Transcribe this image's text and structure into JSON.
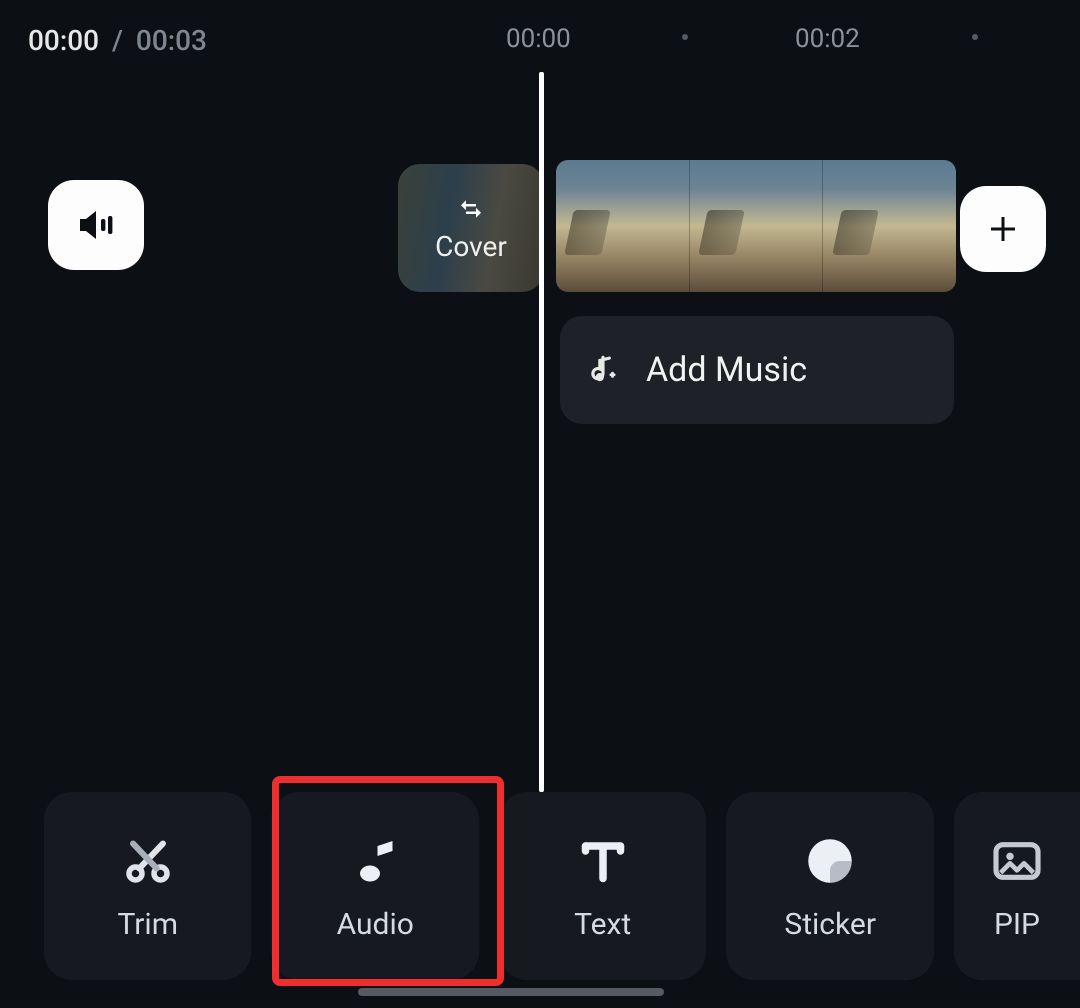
{
  "timecode": {
    "current": "00:00",
    "separator": "/",
    "total": "00:03"
  },
  "ruler": {
    "marks": [
      "00:00",
      "00:02"
    ]
  },
  "cover": {
    "label": "Cover"
  },
  "add_music": {
    "label": "Add Music"
  },
  "toolbar": {
    "items": [
      {
        "id": "trim",
        "label": "Trim"
      },
      {
        "id": "audio",
        "label": "Audio"
      },
      {
        "id": "text",
        "label": "Text"
      },
      {
        "id": "sticker",
        "label": "Sticker"
      },
      {
        "id": "pip",
        "label": "PIP"
      }
    ],
    "highlighted": "audio"
  }
}
